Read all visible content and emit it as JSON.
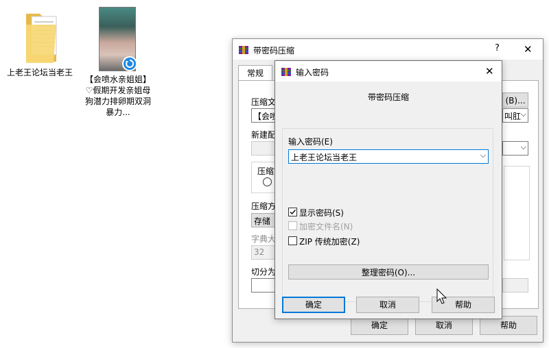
{
  "desktop": {
    "icons": [
      {
        "label": "上老王论坛当老王",
        "icon": "folder-icon"
      },
      {
        "label": "【会喷水亲姐姐】♡假期开发亲姐母狗潜力排卵期双洞暴力...",
        "icon": "video-thumbnail-icon"
      }
    ]
  },
  "back_dialog": {
    "title": "带密码压缩",
    "help": "?",
    "close": "✕",
    "tab_general": "常规",
    "label_archive_name": "压缩文",
    "archive_name_value": "【会喷",
    "browse_label": "(B)...",
    "profile_value": "叫肛",
    "label_update_mode": "新建配",
    "group_format": "压缩文",
    "label_method": "压缩方",
    "method_value": "存储",
    "label_dict": "字典大",
    "dict_value": "32",
    "label_split": "切分为",
    "ok_label": "确定",
    "cancel_label": "取消",
    "help_label": "帮助"
  },
  "password_dialog": {
    "title": "输入密码",
    "close": "✕",
    "heading": "带密码压缩",
    "password_label": "输入密码(E)",
    "password_value": "上老王论坛当老王",
    "show_password_label": "显示密码(S)",
    "show_password_checked": true,
    "encrypt_filenames_label": "加密文件名(N)",
    "encrypt_filenames_checked": false,
    "zip_legacy_label": "ZIP 传统加密(Z)",
    "zip_legacy_checked": false,
    "organize_label": "整理密码(O)...",
    "ok_label": "确定",
    "cancel_label": "取消",
    "help_label": "帮助"
  },
  "colors": {
    "focus_blue": "#0078d7",
    "dialog_face": "#f0f0f0",
    "button_face": "#e1e1e1"
  }
}
